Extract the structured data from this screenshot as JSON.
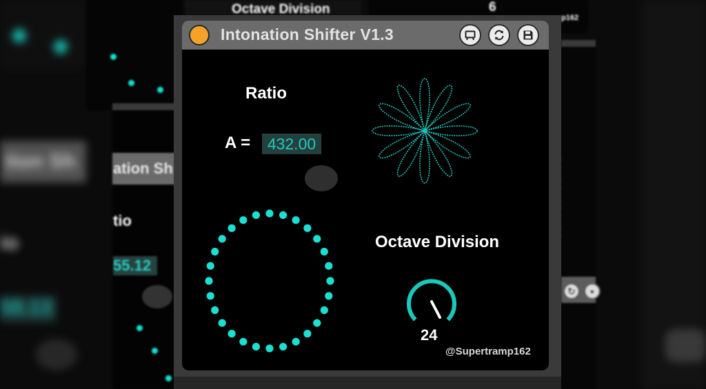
{
  "device": {
    "title": "Intonation Shifter V1.3",
    "ratio_label": "Ratio",
    "a_label": "A =",
    "a_value": "432.00",
    "octave_label": "Octave Division",
    "octave_value": "24",
    "handle": "@Supertramp162",
    "buttons": [
      "screen-icon",
      "refresh-icon",
      "save-icon"
    ]
  },
  "background_panels": {
    "top_label": "Octave Division",
    "top_value": "6",
    "top_handle": "p162",
    "title_fragment": "ation Sh",
    "ratio_fragment": "tio",
    "value_fragment": "55.12",
    "far_title_fragment": "tion Sh",
    "far_ratio_fragment": "io",
    "far_value_fragment": "58.13"
  },
  "colors": {
    "accent": "#22c9c0",
    "power": "#f5a22b",
    "titlebar": "#6b6b6b"
  }
}
